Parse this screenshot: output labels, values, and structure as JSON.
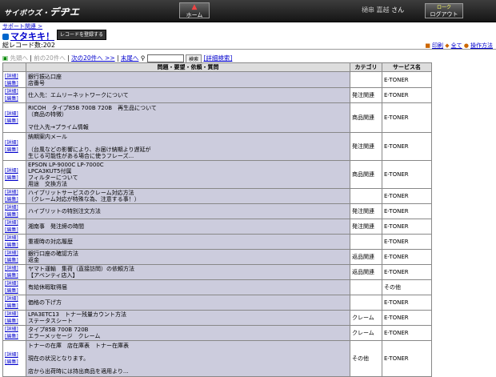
{
  "header": {
    "logo_small": "サイボウズ・",
    "logo_big": "デヂエ",
    "home": "ホーム",
    "user_name": "樋串 嘉越",
    "user_suffix": "さん",
    "logout_top": "ロ一ク",
    "logout": "ログアウト"
  },
  "breadcrumb": "サポート関連 >",
  "page_title": "マタキキ！",
  "register_button": "レコードを登録する",
  "record_count": "総レコード数:202",
  "top_links": {
    "print": "印刷",
    "all": "全て",
    "ops": "操作方法"
  },
  "nav": {
    "first": "先頭へ",
    "prev": "前の20件へ",
    "next": "次の20件へ >>",
    "last": "末尾へ",
    "search_button": "検索",
    "detail_search": "[詳細検索]"
  },
  "columns": {
    "question": "問題・要望・依頼・質問",
    "category": "カテゴリ",
    "service": "サービス名"
  },
  "edit_links": {
    "detail": "[詳細]",
    "edit": "[編集]"
  },
  "rows": [
    {
      "q": [
        "銀行振込口座",
        "店番号"
      ],
      "cat": "",
      "svc": "E-TONER"
    },
    {
      "q": [
        "仕入先：エムリーネットワークについて"
      ],
      "cat": "発注関連",
      "svc": "E-TONER"
    },
    {
      "q": [
        "RICOH　タイプ85B 700B 720B　再生品について",
        "（商品の特徴）",
        "",
        "マ仕入先→プライム情報"
      ],
      "cat": "商品関連",
      "svc": "E-TONER"
    },
    {
      "q": [
        "納期案内メール",
        "",
        "（台風などの影響により、お届け納期より遅延が",
        "生じる可能性がある場合に使うフレーズ..."
      ],
      "cat": "発注関連",
      "svc": "E-TONER"
    },
    {
      "q": [
        "EPSON LP-9000C LP-7000C",
        "LPCA3KUT5付属",
        "フィルターについて",
        "用途　交換方法"
      ],
      "cat": "商品関連",
      "svc": "E-TONER"
    },
    {
      "q": [
        "ハイブリットサービスのクレーム対応方法",
        "（クレーム対応が特殊な為、注意する事！）"
      ],
      "cat": "",
      "svc": "E-TONER"
    },
    {
      "q": [
        "ハイブリットの特別注文方法"
      ],
      "cat": "発注関連",
      "svc": "E-TONER"
    },
    {
      "q": [
        "湘南事　発注締の時間"
      ],
      "cat": "発注関連",
      "svc": "E-TONER"
    },
    {
      "q": [
        "重複時の対応履歴"
      ],
      "cat": "",
      "svc": "E-TONER"
    },
    {
      "q": [
        "銀行口座の確認方法",
        "返金"
      ],
      "cat": "返品関連",
      "svc": "E-TONER"
    },
    {
      "q": [
        "ヤマト運輸　集荷（直接訪問）の依頼方法",
        "【アベンティ店入】"
      ],
      "cat": "返品関連",
      "svc": "E-TONER"
    },
    {
      "q": [
        "有給休暇取得届"
      ],
      "cat": "",
      "svc": "その他"
    },
    {
      "q": [
        "価格の下げ方"
      ],
      "cat": "",
      "svc": "E-TONER"
    },
    {
      "q": [
        "LPA3ETC13　トナー残量カウント方法",
        "ステータスシート"
      ],
      "cat": "クレーム",
      "svc": "E-TONER"
    },
    {
      "q": [
        "タイプ85B 700B 720B",
        "エラーメッセージ　クレーム"
      ],
      "cat": "クレーム",
      "svc": "E-TONER"
    },
    {
      "q": [
        "トナーの在庫　店在庫表　トナー在庫表",
        "",
        "現在の状況となります。",
        "",
        "店から出荷時には持出商品を適用より..."
      ],
      "cat": "その他",
      "svc": "E-TONER"
    }
  ]
}
